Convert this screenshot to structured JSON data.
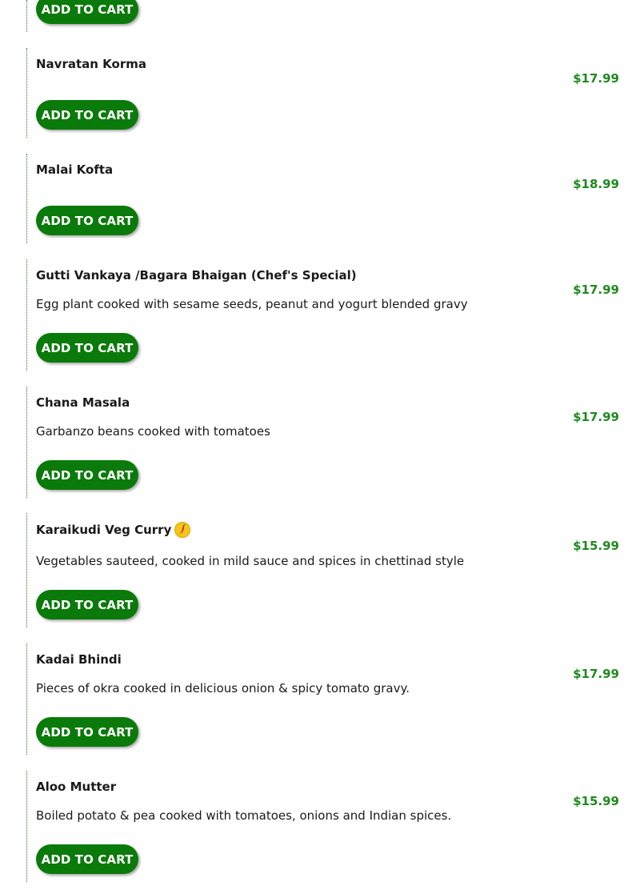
{
  "colors": {
    "button_bg": "#0a7a0a",
    "price": "#1e8a1e",
    "divider": "#1f7a1f",
    "chili_badge": "#f5c518",
    "chili": "#d32f2f"
  },
  "add_to_cart_label": "ADD TO CART",
  "items": [
    {
      "name": "",
      "description": "",
      "price": ""
    },
    {
      "name": "Navratan Korma",
      "description": "",
      "price": "$17.99"
    },
    {
      "name": "Malai Kofta",
      "description": "",
      "price": "$18.99"
    },
    {
      "name": "Gutti Vankaya /Bagara Bhaigan (Chef's Special)",
      "description": "Egg plant cooked with sesame seeds, peanut and yogurt blended gravy",
      "price": "$17.99"
    },
    {
      "name": "Chana Masala",
      "description": "Garbanzo beans cooked with tomatoes",
      "price": "$17.99"
    },
    {
      "name": "Karaikudi Veg Curry",
      "description": "Vegetables sauteed, cooked in mild sauce and spices in chettinad style",
      "price": "$15.99",
      "icon": "chili-spicy-icon"
    },
    {
      "name": "Kadai Bhindi",
      "description": "Pieces of okra cooked in delicious onion & spicy tomato gravy.",
      "price": "$17.99"
    },
    {
      "name": "Aloo Mutter",
      "description": "Boiled potato & pea cooked with tomatoes, onions and Indian spices.",
      "price": "$15.99"
    }
  ]
}
